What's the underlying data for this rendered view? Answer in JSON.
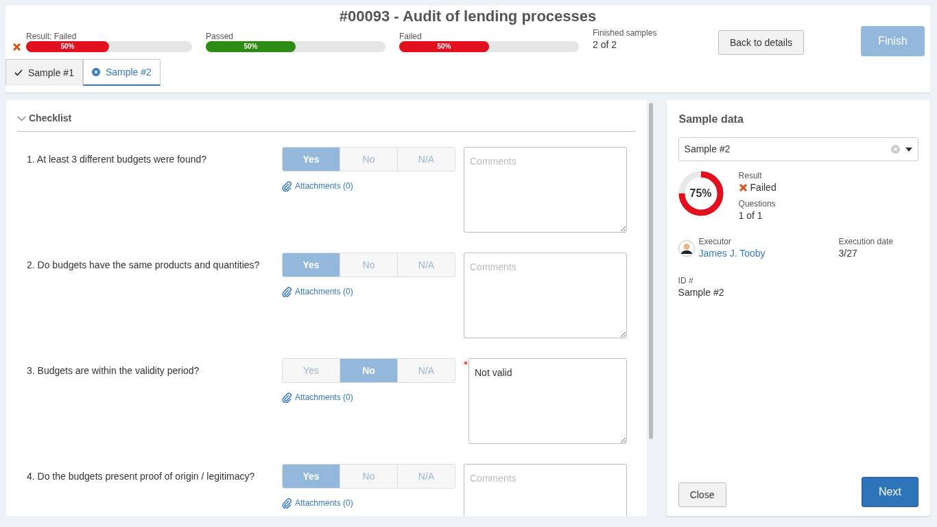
{
  "header": {
    "title": "#00093 - Audit of lending processes",
    "progress": [
      {
        "label": "Result: Failed",
        "value": "50%",
        "level": 0.5,
        "color": "#e0101f",
        "failed_mark": true
      },
      {
        "label": "Passed",
        "value": "50%",
        "level": 0.5,
        "color": "#2e8b14",
        "failed_mark": false
      },
      {
        "label": "Failed",
        "value": "50%",
        "level": 0.5,
        "color": "#e0101f",
        "failed_mark": false
      }
    ],
    "finished": {
      "label": "Finished samples",
      "value": "2 of 2"
    },
    "back_button": "Back to details",
    "finish_button": {
      "label": "Finish",
      "disabled": true
    }
  },
  "tabs": [
    {
      "label": "Sample #1",
      "selected": false,
      "failed": false
    },
    {
      "label": "Sample #2",
      "selected": true,
      "failed": true
    }
  ],
  "checklist": {
    "title": "Checklist",
    "expanded": true,
    "questions": [
      {
        "text": "1. At least 3 different budgets were found?",
        "options": [
          {
            "label": "Yes",
            "selected": true
          },
          {
            "label": "No",
            "selected": false
          },
          {
            "label": "N/A",
            "selected": false
          }
        ],
        "attachments": "Attachments (0)",
        "placeholder": "Comments",
        "required": false
      },
      {
        "text": "2. Do budgets have the same products and quantities?",
        "options": [
          {
            "label": "Yes",
            "selected": true
          },
          {
            "label": "No",
            "selected": false
          },
          {
            "label": "N/A",
            "selected": false
          }
        ],
        "attachments": "Attachments (0)",
        "placeholder": "Comments",
        "required": false
      },
      {
        "text": "3. Budgets are within the validity period?",
        "options": [
          {
            "label": "Yes",
            "selected": false
          },
          {
            "label": "No",
            "selected": true
          },
          {
            "label": "N/A",
            "selected": false
          }
        ],
        "attachments": "Attachments (0)",
        "comment": "Not valid",
        "required": true
      },
      {
        "text": "4. Do the budgets present proof of origin / legitimacy?",
        "options": [
          {
            "label": "Yes",
            "selected": true
          },
          {
            "label": "No",
            "selected": false
          },
          {
            "label": "N/A",
            "selected": false
          }
        ],
        "attachments": "Attachments (0)",
        "placeholder": "Comments",
        "required": false
      }
    ]
  },
  "sample_data": {
    "title": "Sample data",
    "select_value": "Sample #2",
    "score": {
      "level": 0.75,
      "text": "75%"
    },
    "result_label": "Result",
    "result_value": "Failed",
    "result_failed": true,
    "questions_label": "Questions",
    "questions_value": "1 of 1",
    "executor_label": "Executor",
    "executor_name": "James J. Tooby",
    "date_label": "Execution date",
    "date_value": "3/27",
    "id_label": "ID #",
    "id_value": "Sample #2",
    "close_button": "Close",
    "next_button": "Next"
  }
}
